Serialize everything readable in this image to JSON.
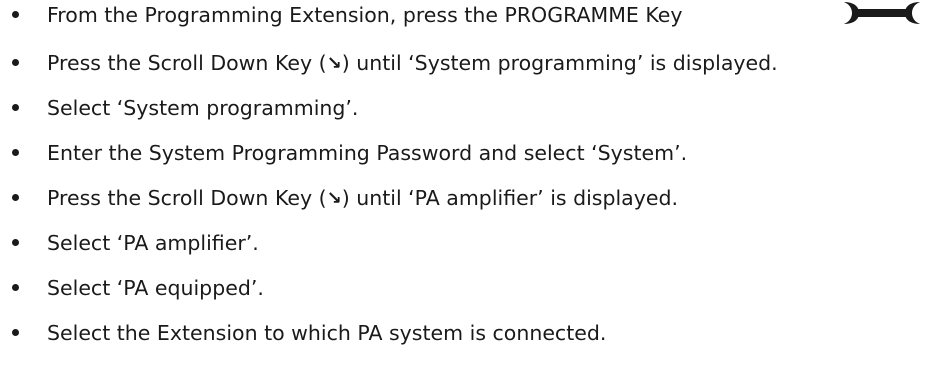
{
  "steps": [
    {
      "text": "From the Programming Extension, press the PROGRAMME Key"
    },
    {
      "before": "Press the Scroll Down Key (",
      "key_glyph": "↘",
      "after": ") until ‘System programming’ is displayed."
    },
    {
      "text": "Select ‘System programming’."
    },
    {
      "text": "Enter the System Programming Password and select ‘System’."
    },
    {
      "before": "Press the Scroll Down Key (",
      "key_glyph": "↘",
      "after": ") until ‘PA amplifier’ is displayed."
    },
    {
      "text": "Select ‘PA amplifier’."
    },
    {
      "text": "Select ‘PA equipped’."
    },
    {
      "text": "Select the Extension to which PA system is connected."
    }
  ],
  "icons": {
    "programme_key": "wrench-icon",
    "scroll_down_key": "scroll-down-arrow-icon"
  },
  "colors": {
    "text": "#1a1a1a",
    "background": "#ffffff"
  }
}
